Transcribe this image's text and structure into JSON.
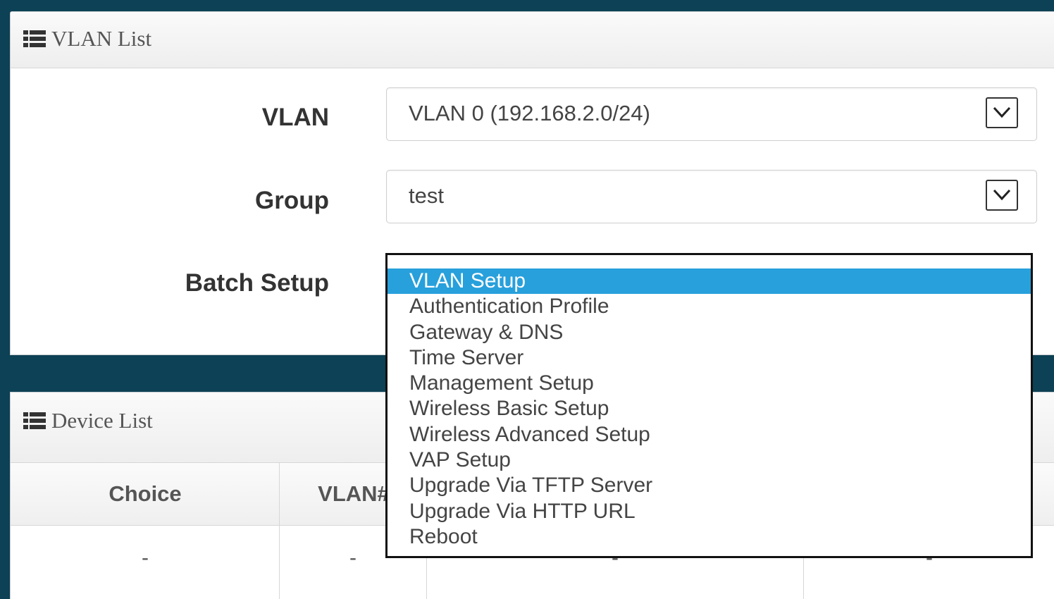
{
  "vlan_panel": {
    "title": "VLAN List",
    "vlan_label": "VLAN",
    "vlan_value": "VLAN 0 (192.168.2.0/24)",
    "group_label": "Group",
    "group_value": "test",
    "batch_label": "Batch Setup"
  },
  "batch_dropdown": {
    "selected_index": 0,
    "options": [
      "VLAN Setup",
      "Authentication Profile",
      "Gateway & DNS",
      "Time Server",
      "Management Setup",
      "Wireless Basic Setup",
      "Wireless Advanced Setup",
      "VAP Setup",
      "Upgrade Via TFTP Server",
      "Upgrade Via HTTP URL",
      "Reboot"
    ]
  },
  "device_panel": {
    "title": "Device List",
    "columns": [
      "Choice",
      "VLAN#"
    ],
    "row": [
      "-",
      "-",
      "-",
      "-"
    ]
  },
  "colors": {
    "background": "#0d4155",
    "selected_option": "#27a0dc"
  },
  "icons": {
    "panel_title": "list-icon",
    "select_toggle": "chevron-down-icon"
  }
}
